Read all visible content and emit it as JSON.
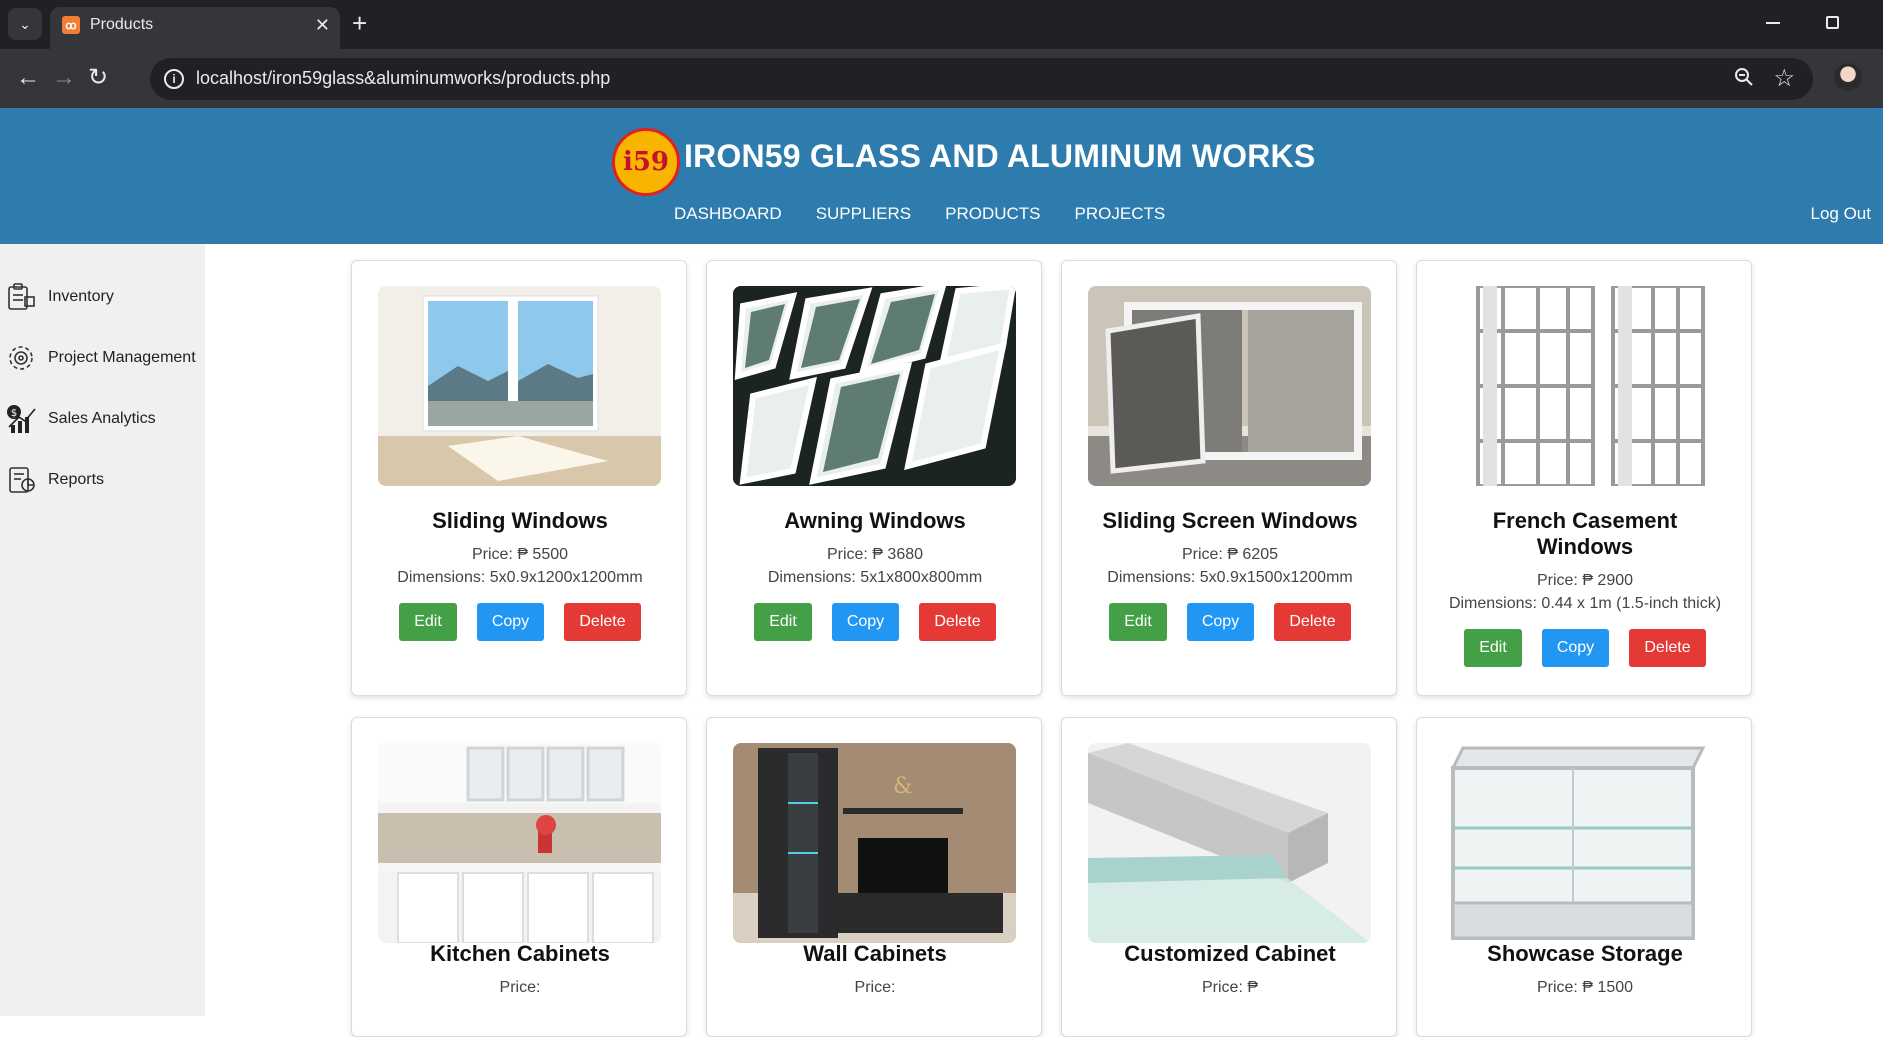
{
  "browser": {
    "tab_title": "Products",
    "url": "localhost/iron59glass&aluminumworks/products.php",
    "new_tab": "+",
    "close_tab": "✕"
  },
  "header": {
    "logo_text": "i59",
    "title": "IRON59 GLASS AND ALUMINUM WORKS",
    "nav": [
      "DASHBOARD",
      "SUPPLIERS",
      "PRODUCTS",
      "PROJECTS"
    ],
    "logout": "Log Out"
  },
  "sidebar": {
    "items": [
      {
        "label": "Inventory",
        "icon": "inventory-icon"
      },
      {
        "label": "Project Management",
        "icon": "project-gear-icon"
      },
      {
        "label": "Sales Analytics",
        "icon": "sales-chart-icon"
      },
      {
        "label": "Reports",
        "icon": "report-icon"
      }
    ]
  },
  "actions": {
    "edit": "Edit",
    "copy": "Copy",
    "delete": "Delete"
  },
  "products": [
    {
      "name": "Sliding Windows",
      "price": "Price: ₱ 5500",
      "dimensions": "Dimensions: 5x0.9x1200x1200mm"
    },
    {
      "name": "Awning Windows",
      "price": "Price: ₱ 3680",
      "dimensions": "Dimensions: 5x1x800x800mm"
    },
    {
      "name": "Sliding Screen Windows",
      "price": "Price: ₱ 6205",
      "dimensions": "Dimensions: 5x0.9x1500x1200mm"
    },
    {
      "name_line1": "French Casement",
      "name_line2": "Windows",
      "price": "Price: ₱ 2900",
      "dimensions": "Dimensions: 0.44 x 1m (1.5-inch thick)"
    },
    {
      "name": "Kitchen Cabinets",
      "price": "Price:"
    },
    {
      "name": "Wall Cabinets",
      "price": "Price:"
    },
    {
      "name": "Customized Cabinet",
      "price": "Price: ₱"
    },
    {
      "name": "Showcase Storage",
      "price": "Price: ₱ 1500"
    }
  ],
  "colors": {
    "header": "#2e7bad",
    "edit": "#43a047",
    "copy": "#2196f3",
    "delete": "#e53935"
  }
}
